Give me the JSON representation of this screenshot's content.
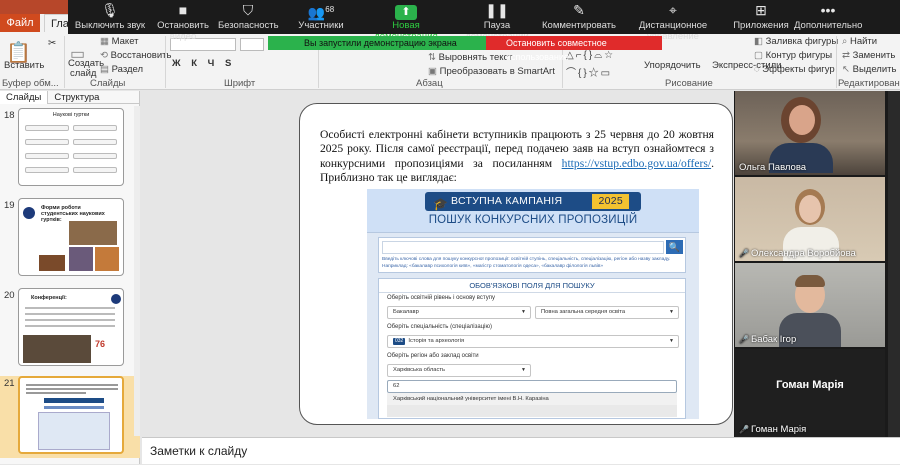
{
  "app": {
    "file_tab": "Файл",
    "main_tab": "Главн"
  },
  "zoom_toolbar": {
    "mute": "Выключить звук",
    "video": "Остановить видео",
    "security": "Безопасность",
    "participants": "Участники",
    "participants_count": "68",
    "new_share": "Новая демонстрация",
    "pause_share": "Пауза демонстрации",
    "annotate": "Комментировать",
    "remote_control": "Дистанционное управление",
    "apps": "Приложения",
    "more": "Дополнительно"
  },
  "share_banner": {
    "status": "Вы запустили демонстрацию экрана",
    "stop": "Остановить совместное использование"
  },
  "ribbon": {
    "paste": "Вставить",
    "clipboard": "Буфер обм...",
    "layout": "Макет",
    "reset": "Восстановить",
    "new_slide": "Создать",
    "new_slide2": "слайд",
    "section": "Раздел",
    "slides_group": "Слайды",
    "font_group": "Шрифт",
    "paragraph_group": "Абзац",
    "align_text": "Выровнять текст",
    "smartart": "Преобразовать в SmartArt",
    "arrange": "Упорядочить",
    "quick_styles": "Экспресс-стили",
    "drawing_group": "Рисование",
    "shape_fill": "Заливка фигуры",
    "shape_outline": "Контур фигуры",
    "shape_effects": "Эффекты фигур",
    "find": "Найти",
    "replace": "Заменить",
    "select": "Выделить",
    "editing_group": "Редактирование"
  },
  "slides_panel": {
    "tab_slides": "Слайды",
    "tab_outline": "Структура",
    "slides": [
      {
        "num": "18",
        "title": "Наукові гуртки"
      },
      {
        "num": "19",
        "title": "Форми роботи студентських наукових гуртків:"
      },
      {
        "num": "20",
        "title": "Конференції:"
      },
      {
        "num": "21",
        "title": ""
      }
    ]
  },
  "slide": {
    "text_main": "Особисті електронні кабінети вступників працюють з 25 червня до 20 жовтня 2025 року. Після самої реєстрації, перед подачею заяв на вступ ознайомтеся з конкурсними пропозиціями за посиланням",
    "link": "https://vstup.edbo.gov.ua/offers/",
    "text_after": ". Приблизно так це виглядає:",
    "campaign": "ВСТУПНА КАМПАНІЯ",
    "year": "2025",
    "search_title": "ПОШУК КОНКУРСНИХ ПРОПОЗИЦІЙ",
    "hint1": "Введіть ключові слова для пошуку конкурсної пропозиції: освітній ступінь, спеціальність, спеціалізацію, регіон або назву закладу.",
    "hint2": "Наприклад: «бакалавр психологія київ», «магістр стоматологія одеса», «бакалавр філологія львів»",
    "filters_title": "ОБОВ'ЯЗКОВІ ПОЛЯ ДЛЯ ПОШУКУ",
    "level_label": "Оберіть освітній рівень і основу вступу",
    "level_value": "Бакалавр",
    "base_value": "Повна загальна середня освіта",
    "spec_label": "Оберіть спеціальність (спеціалізацію)",
    "spec_code": "032",
    "spec_value": "Історія та археологія",
    "region_label": "Оберіть регіон або заклад освіти",
    "region_value": "Харківська область",
    "input_value": "62",
    "university": "Харківський національний університет імені В.Н. Каразіна"
  },
  "notes": {
    "placeholder": "Заметки к слайду"
  },
  "participants": [
    {
      "name": "Ольга Павлова",
      "muted": false
    },
    {
      "name": "Олександра Воробйова",
      "muted": true
    },
    {
      "name": "Бабак Ігор",
      "muted": true
    },
    {
      "name": "Гоман Марія",
      "muted": true
    }
  ]
}
